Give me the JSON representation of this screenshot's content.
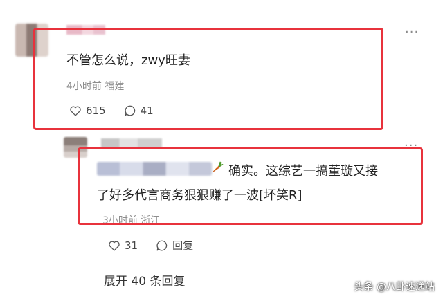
{
  "comment1": {
    "text": "不管怎么说，zwy旺妻",
    "meta": "4小时前 福建",
    "likes": "615",
    "replies": "41",
    "more": "···"
  },
  "comment2": {
    "text_line1": "确实。这综艺一搞董璇又接",
    "text_line2": "了好多代言商务狠狠赚了一波[坏笑R]",
    "meta": "3小时前 浙江",
    "likes": "31",
    "reply_label": "回复",
    "more": "···"
  },
  "expand_label": "展开 40 条回复",
  "watermark": "头条 @八卦速递站",
  "colors": {
    "highlight_box": "#e8323c",
    "meta_text": "#8e8e8e",
    "carrot": "#e9772a"
  },
  "icons": [
    "heart-icon",
    "comment-icon",
    "more-icon",
    "carrot-emoji-icon"
  ]
}
